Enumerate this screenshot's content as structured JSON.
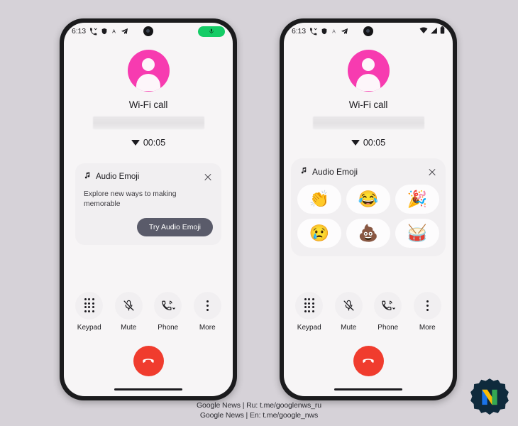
{
  "page": {
    "background_color": "#d6d2d8"
  },
  "footer": {
    "line1": "Google News | Ru: t.me/googlenws_ru",
    "line2": "Google News | En: t.me/google_nws"
  },
  "logo": {
    "name": "n-badge-logo",
    "letter": "N",
    "colors": [
      "#1a73e8",
      "#fbbc04",
      "#34a853",
      "#102a3c"
    ]
  },
  "phones": {
    "left": {
      "status_bar": {
        "time": "6:13",
        "left_icons": [
          "missed-call-icon",
          "shield-icon",
          "letter-a-icon",
          "telegram-send-icon"
        ],
        "right_indicator": "mic-active-pill",
        "mic_pill_color": "#15cc66"
      },
      "call": {
        "title": "Wi-Fi call",
        "number_redacted": true,
        "duration": "00:05",
        "avatar_color": "#f73bb0"
      },
      "promo_card": {
        "icon": "music-note-icon",
        "title": "Audio Emoji",
        "body": "Explore new ways to making memorable",
        "button_label": "Try Audio Emoji",
        "button_color": "#5a5b6a",
        "close_icon": "close-icon"
      },
      "controls": [
        {
          "label": "Keypad",
          "icon": "keypad-icon"
        },
        {
          "label": "Mute",
          "icon": "mic-off-icon"
        },
        {
          "label": "Phone",
          "icon": "phone-audio-route-icon"
        },
        {
          "label": "More",
          "icon": "more-vertical-icon"
        }
      ],
      "end_call": {
        "label": "End call",
        "color": "#f03c2e",
        "icon": "call-end-icon"
      }
    },
    "right": {
      "status_bar": {
        "time": "6:13",
        "left_icons": [
          "missed-call-icon",
          "shield-icon",
          "letter-a-icon",
          "telegram-send-icon"
        ],
        "right_icons": [
          "wifi-icon",
          "signal-icon",
          "battery-icon"
        ]
      },
      "call": {
        "title": "Wi-Fi call",
        "number_redacted": true,
        "duration": "00:05",
        "avatar_color": "#f73bb0"
      },
      "emoji_panel": {
        "icon": "music-note-icon",
        "title": "Audio Emoji",
        "close_icon": "close-icon",
        "emojis": [
          {
            "name": "clapping-hands",
            "glyph": "👏"
          },
          {
            "name": "face-with-tears-of-joy",
            "glyph": "😂"
          },
          {
            "name": "party-popper",
            "glyph": "🎉"
          },
          {
            "name": "crying-face",
            "glyph": "😢"
          },
          {
            "name": "pile-of-poo",
            "glyph": "💩"
          },
          {
            "name": "drum",
            "glyph": "🥁"
          }
        ]
      },
      "controls": [
        {
          "label": "Keypad",
          "icon": "keypad-icon"
        },
        {
          "label": "Mute",
          "icon": "mic-off-icon"
        },
        {
          "label": "Phone",
          "icon": "phone-audio-route-icon"
        },
        {
          "label": "More",
          "icon": "more-vertical-icon"
        }
      ],
      "end_call": {
        "label": "End call",
        "color": "#f03c2e",
        "icon": "call-end-icon"
      }
    }
  }
}
